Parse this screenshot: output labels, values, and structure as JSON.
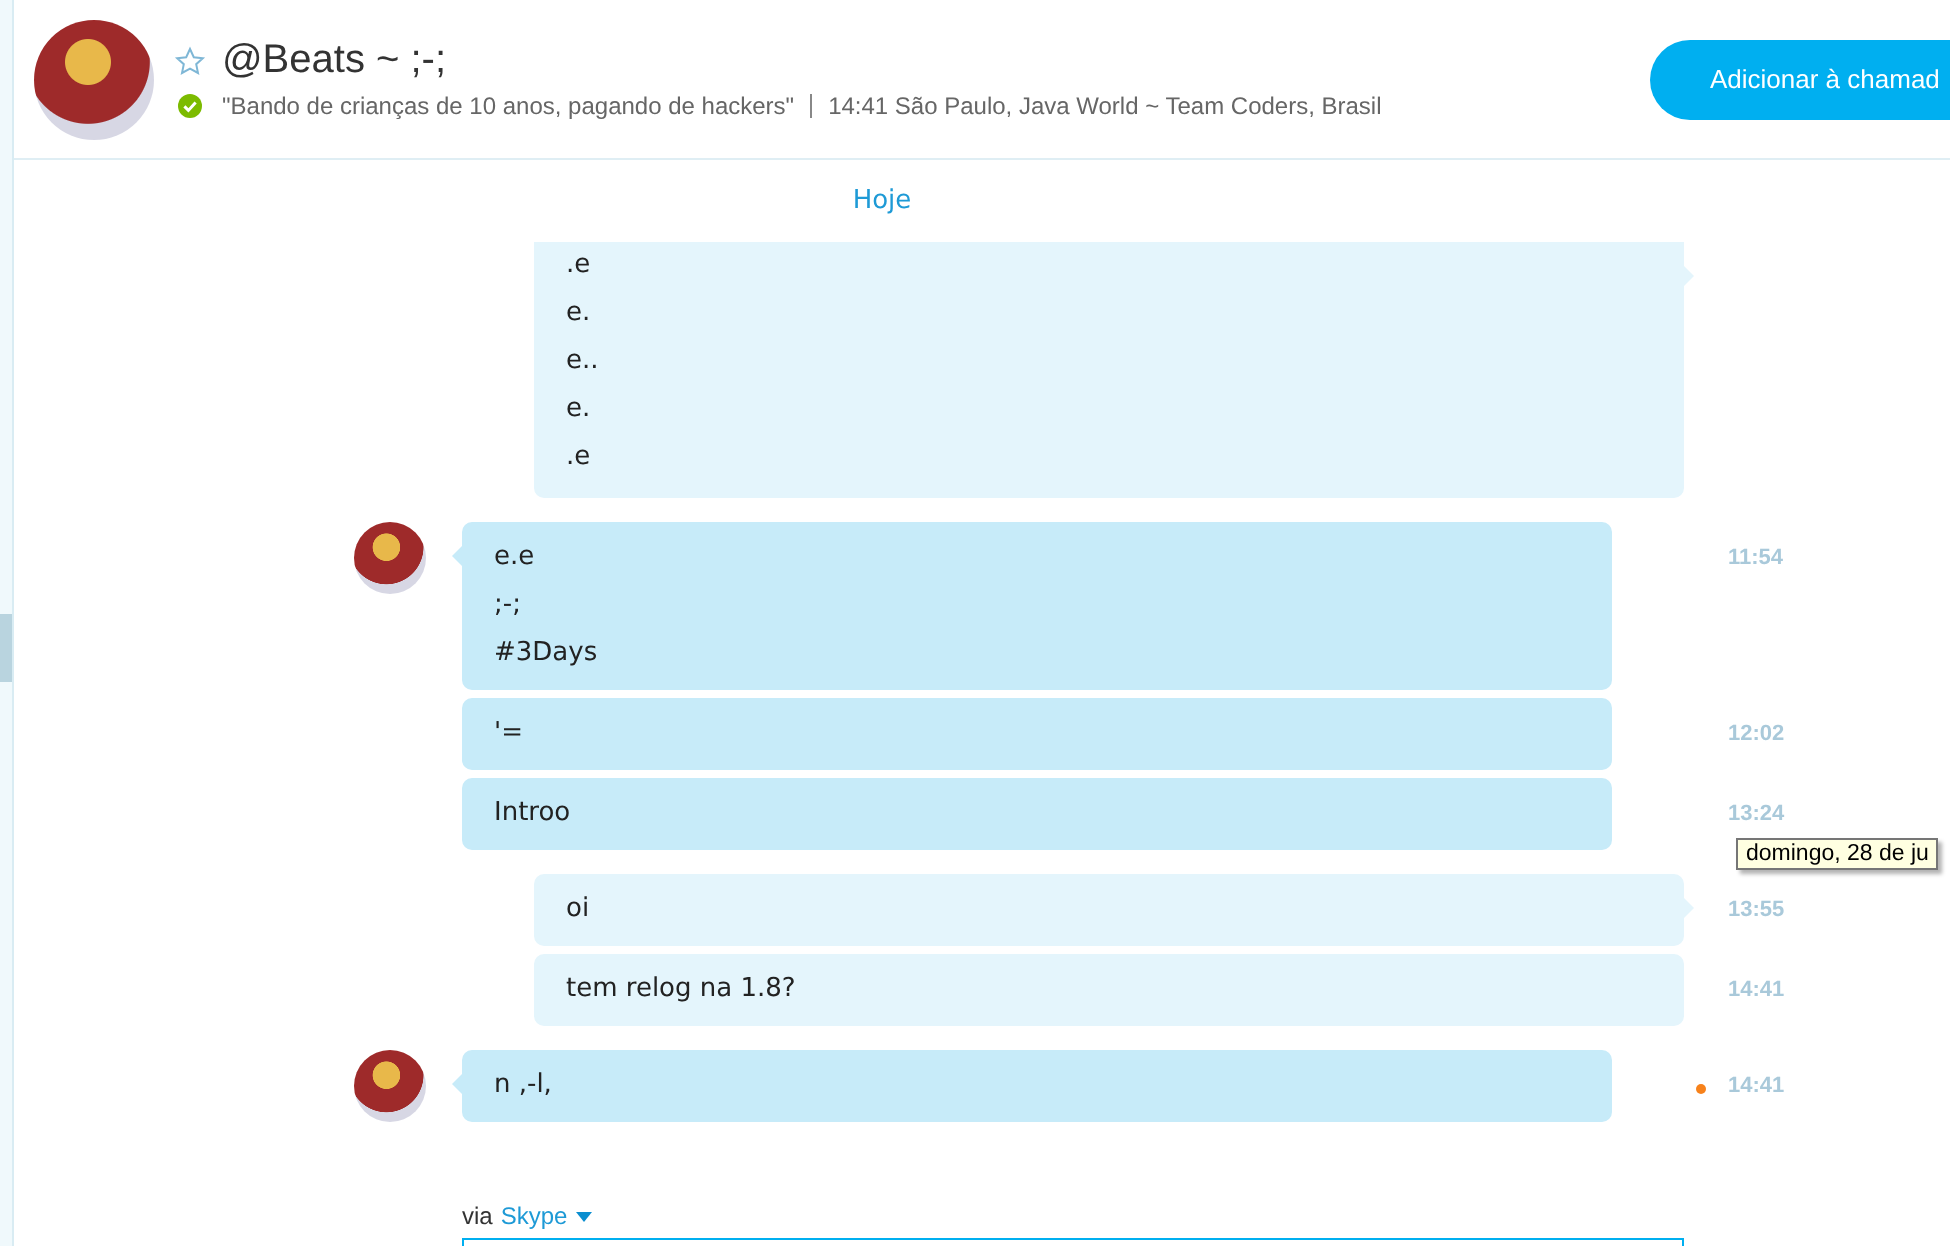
{
  "header": {
    "name": "@Beats ~ ;-;",
    "starred": false,
    "online": true,
    "mood": "\"Bando de crianças de 10 anos, pagando de hackers\"",
    "location": "14:41 São Paulo, Java World ~ Team Coders, Brasil",
    "call_button": "Adicionar à chamad"
  },
  "date_separator": "Hoje",
  "groups": [
    {
      "kind": "outgoing",
      "messages": [
        {
          "lines": [
            ".e",
            "e.",
            "e..",
            "e.",
            ".e"
          ]
        }
      ]
    },
    {
      "kind": "incoming",
      "messages": [
        {
          "lines": [
            "e.e",
            ";-;",
            "#3Days"
          ],
          "time": "11:54"
        },
        {
          "lines": [
            "'="
          ],
          "time": "12:02"
        },
        {
          "lines": [
            "Introo"
          ],
          "time": "13:24",
          "tooltip": "domingo, 28 de ju"
        }
      ]
    },
    {
      "kind": "outgoing",
      "messages": [
        {
          "lines": [
            "oi"
          ],
          "time": "13:55"
        },
        {
          "lines": [
            "tem relog na 1.8?"
          ],
          "time": "14:41"
        }
      ]
    },
    {
      "kind": "incoming",
      "messages": [
        {
          "lines": [
            "n ,-l,"
          ],
          "time": "14:41",
          "unread": true
        }
      ]
    }
  ],
  "compose": {
    "via": "via",
    "service": "Skype"
  }
}
